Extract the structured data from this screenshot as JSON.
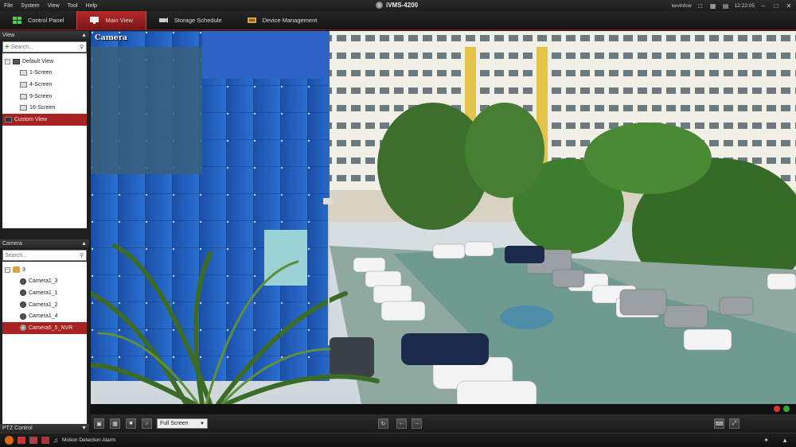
{
  "menubar": {
    "items": [
      "File",
      "System",
      "View",
      "Tool",
      "Help"
    ]
  },
  "app": {
    "title": "iVMS-4200"
  },
  "topright": {
    "user": "kevinfcw",
    "time": "12:22:05"
  },
  "tabs": [
    {
      "label": "Control Panel"
    },
    {
      "label": "Main View"
    },
    {
      "label": "Storage Schedule"
    },
    {
      "label": "Device Management"
    }
  ],
  "view_panel": {
    "title": "View",
    "search_placeholder": "Search...",
    "items": [
      "Default View",
      "1-Screen",
      "4-Screen",
      "9-Screen",
      "16-Screen",
      "Custom View"
    ]
  },
  "camera_panel": {
    "title": "Camera",
    "search_placeholder": "Search...",
    "group": "3",
    "items": [
      "Camera1_3",
      "Camera1_1",
      "Camera1_2",
      "Camera1_4",
      "Camera5_5_NVR"
    ]
  },
  "ptz": {
    "title": "PTZ Control"
  },
  "video": {
    "label": "Camera"
  },
  "controls": {
    "screen_mode": "Full Screen"
  },
  "status": {
    "alarm_label": "Motion Detection Alarm"
  },
  "colors": {
    "accent": "#a82222",
    "background": "#1a1a1a"
  }
}
